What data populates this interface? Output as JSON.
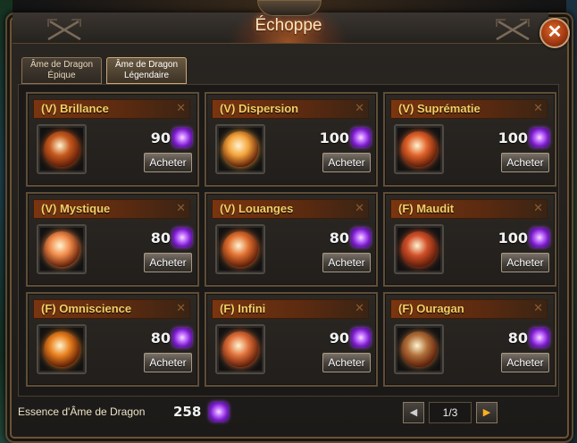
{
  "window": {
    "title": "Échoppe",
    "close_symbol": "✕"
  },
  "tabs": [
    {
      "line1": "Âme de Dragon",
      "line2": "Épique",
      "selected": false
    },
    {
      "line1": "Âme de Dragon",
      "line2": "Légendaire",
      "selected": true
    }
  ],
  "items": [
    {
      "name": "(V) Brillance",
      "price": "90",
      "buy_label": "Acheter",
      "orb_color": "#c65a1e"
    },
    {
      "name": "(V) Dispersion",
      "price": "100",
      "buy_label": "Acheter",
      "orb_color": "#f3a33a"
    },
    {
      "name": "(V) Suprématie",
      "price": "100",
      "buy_label": "Acheter",
      "orb_color": "#e0622a"
    },
    {
      "name": "(V) Mystique",
      "price": "80",
      "buy_label": "Acheter",
      "orb_color": "#f08a4a"
    },
    {
      "name": "(V) Louanges",
      "price": "80",
      "buy_label": "Acheter",
      "orb_color": "#e07030"
    },
    {
      "name": "(F) Maudit",
      "price": "100",
      "buy_label": "Acheter",
      "orb_color": "#d0502a"
    },
    {
      "name": "(F) Omniscience",
      "price": "80",
      "buy_label": "Acheter",
      "orb_color": "#e8801e"
    },
    {
      "name": "(F) Infini",
      "price": "90",
      "buy_label": "Acheter",
      "orb_color": "#e0703a"
    },
    {
      "name": "(F) Ouragan",
      "price": "80",
      "buy_label": "Acheter",
      "orb_color": "#b0703a"
    }
  ],
  "footer": {
    "essence_label": "Essence d'Âme de Dragon",
    "essence_value": "258",
    "page_indicator": "1/3",
    "prev_symbol": "◀",
    "next_symbol": "▶"
  },
  "icons": {
    "currency": "purple-gem-icon",
    "title_decor": "crossed-swords-icon",
    "close": "close-icon"
  },
  "colors": {
    "accent": "#f3d066",
    "header_band": "#7a3510",
    "gem": "#c26cff"
  }
}
